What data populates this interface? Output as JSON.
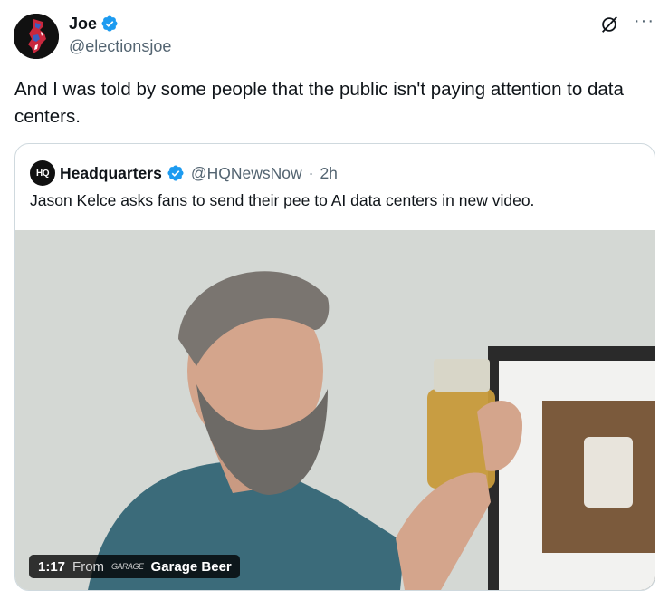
{
  "author": {
    "display_name": "Joe",
    "handle": "@electionsjoe",
    "avatar_icon": "nj-map-avatar"
  },
  "tweet": {
    "text": "And I was told by some people that the public isn't paying attention to data centers."
  },
  "quote": {
    "logo_text": "HQ",
    "display_name": "Headquarters",
    "handle": "@HQNewsNow",
    "separator": "·",
    "time": "2h",
    "text": "Jason Kelce asks fans to send their pee to AI data centers in new video."
  },
  "video": {
    "duration": "1:17",
    "from_label": "From",
    "source_logo_text": "GARAGE",
    "source_name": "Garage Beer"
  },
  "colors": {
    "verified": "#1d9bf0",
    "muted_text": "#536471",
    "border": "#cfd9de"
  }
}
